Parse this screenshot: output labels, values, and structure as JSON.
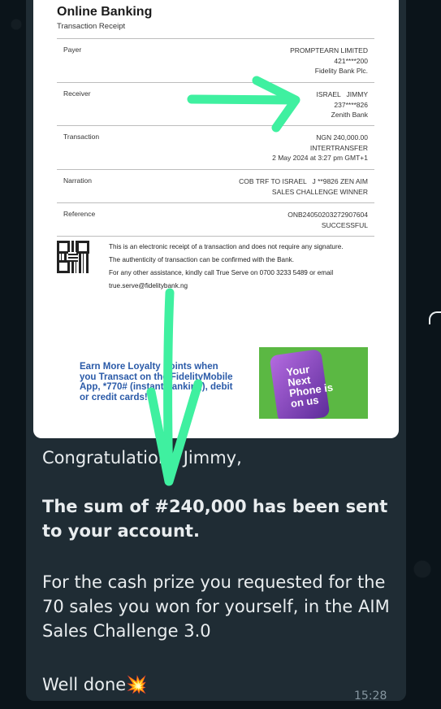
{
  "receipt": {
    "title": "Online Banking",
    "subtitle": "Transaction Receipt",
    "rows": [
      {
        "label": "Payer",
        "values": [
          "PROMPTEARN LIMITED",
          "421****200",
          "Fidelity Bank Plc."
        ]
      },
      {
        "label": "Receiver",
        "values": [
          "ISRAEL   JIMMY",
          "237****826",
          "Zenith Bank"
        ]
      },
      {
        "label": "Transaction",
        "values": [
          "NGN 240,000.00",
          "INTERTRANSFER",
          "2 May 2024 at 3:27 pm GMT+1"
        ]
      },
      {
        "label": "Narration",
        "values": [
          "COB TRF TO ISRAEL   J **9826 ZEN AIM",
          "SALES CHALLENGE WINNER"
        ]
      },
      {
        "label": "Reference",
        "values": [
          "ONB24050203272907604",
          "SUCCESSFUL"
        ]
      }
    ],
    "notice": [
      "This is an electronic receipt of a transaction and does not require any signature.",
      "The authenticity of transaction can be confirmed with the Bank.",
      "For any other assistance, kindly call True Serve on 0700 3233 5489 or email",
      "true.serve@fidelitybank.ng"
    ],
    "promo_text": "Earn More Loyalty Points when you Transact on the FidelityMobile App, *770# (instant banking), debit or credit cards!",
    "promo_image_text": "Your Next Phone is on us"
  },
  "message": {
    "greeting": "Congratulations Jimmy,",
    "line_bold": "The sum of #240,000 has been sent to your account.",
    "body": "For the cash prize you requested for the 70 sales you won for yourself, in the AIM Sales Challenge 3.0",
    "closing": "Well done💥",
    "time": "15:28"
  },
  "colors": {
    "chat_background": "#0b141a",
    "bubble": "#1f2c34",
    "annotation_arrow": "#3ff0a0",
    "message_text": "#e9edef"
  }
}
